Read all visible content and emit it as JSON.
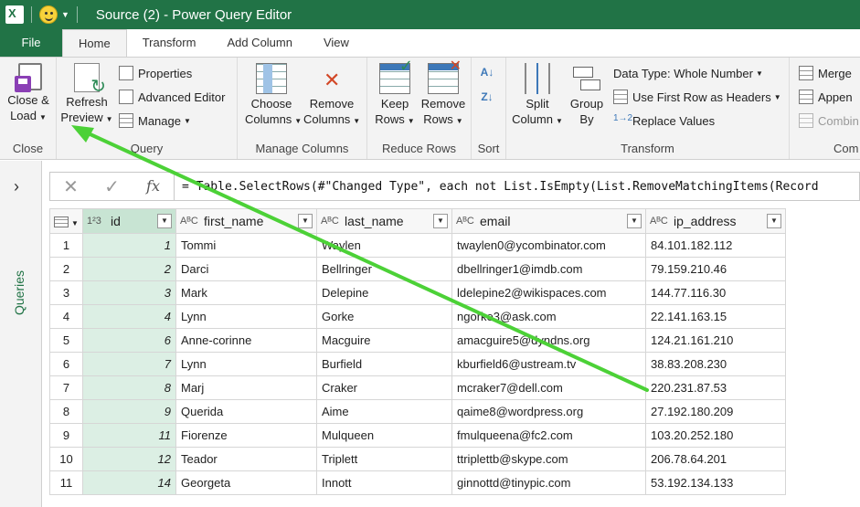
{
  "window": {
    "title": "Source (2) - Power Query Editor"
  },
  "tabs": [
    {
      "label": "File"
    },
    {
      "label": "Home"
    },
    {
      "label": "Transform"
    },
    {
      "label": "Add Column"
    },
    {
      "label": "View"
    }
  ],
  "ribbon": {
    "close": {
      "label1": "Close &",
      "label2": "Load",
      "group": "Close"
    },
    "query": {
      "refresh1": "Refresh",
      "refresh2": "Preview",
      "properties": "Properties",
      "advanced_editor": "Advanced Editor",
      "manage": "Manage",
      "group": "Query"
    },
    "manage_columns": {
      "choose1": "Choose",
      "choose2": "Columns",
      "remove1": "Remove",
      "remove2": "Columns",
      "group": "Manage Columns"
    },
    "reduce_rows": {
      "keep1": "Keep",
      "keep2": "Rows",
      "remove1": "Remove",
      "remove2": "Rows",
      "group": "Reduce Rows"
    },
    "sort": {
      "group": "Sort"
    },
    "transform": {
      "split1": "Split",
      "split2": "Column",
      "group1": "Group",
      "group2": "By",
      "data_type": "Data Type: Whole Number",
      "first_row": "Use First Row as Headers",
      "replace": "Replace Values",
      "group": "Transform"
    },
    "combine": {
      "merge": "Merge",
      "append": "Appen",
      "combine": "Combin",
      "group": "Com"
    }
  },
  "left_pane": {
    "label": "Queries"
  },
  "formula": {
    "text": "= Table.SelectRows(#\"Changed Type\", each not List.IsEmpty(List.RemoveMatchingItems(Record"
  },
  "columns": [
    {
      "type": "1²3",
      "name": "id"
    },
    {
      "type": "AᴮC",
      "name": "first_name"
    },
    {
      "type": "AᴮC",
      "name": "last_name"
    },
    {
      "type": "AᴮC",
      "name": "email"
    },
    {
      "type": "AᴮC",
      "name": "ip_address"
    }
  ],
  "rows": [
    {
      "n": "1",
      "id": "1",
      "first_name": "Tommi",
      "last_name": "Waylen",
      "email": "twaylen0@ycombinator.com",
      "ip": "84.101.182.112"
    },
    {
      "n": "2",
      "id": "2",
      "first_name": "Darci",
      "last_name": "Bellringer",
      "email": "dbellringer1@imdb.com",
      "ip": "79.159.210.46"
    },
    {
      "n": "3",
      "id": "3",
      "first_name": "Mark",
      "last_name": "Delepine",
      "email": "ldelepine2@wikispaces.com",
      "ip": "144.77.116.30"
    },
    {
      "n": "4",
      "id": "4",
      "first_name": "Lynn",
      "last_name": "Gorke",
      "email": "ngorke3@ask.com",
      "ip": "22.141.163.15"
    },
    {
      "n": "5",
      "id": "6",
      "first_name": "Anne-corinne",
      "last_name": "Macguire",
      "email": "amacguire5@dyndns.org",
      "ip": "124.21.161.210"
    },
    {
      "n": "6",
      "id": "7",
      "first_name": "Lynn",
      "last_name": "Burfield",
      "email": "kburfield6@ustream.tv",
      "ip": "38.83.208.230"
    },
    {
      "n": "7",
      "id": "8",
      "first_name": "Marj",
      "last_name": "Craker",
      "email": "mcraker7@dell.com",
      "ip": "220.231.87.53"
    },
    {
      "n": "8",
      "id": "9",
      "first_name": "Querida",
      "last_name": "Aime",
      "email": "qaime8@wordpress.org",
      "ip": "27.192.180.209"
    },
    {
      "n": "9",
      "id": "11",
      "first_name": "Fiorenze",
      "last_name": "Mulqueen",
      "email": "fmulqueena@fc2.com",
      "ip": "103.20.252.180"
    },
    {
      "n": "10",
      "id": "12",
      "first_name": "Teador",
      "last_name": "Triplett",
      "email": "ttriplettb@skype.com",
      "ip": "206.78.64.201"
    },
    {
      "n": "11",
      "id": "14",
      "first_name": "Georgeta",
      "last_name": "Innott",
      "email": "ginnottd@tinypic.com",
      "ip": "53.192.134.133"
    }
  ],
  "colors": {
    "excel_green": "#217346",
    "annotation_arrow": "#4cd137"
  }
}
